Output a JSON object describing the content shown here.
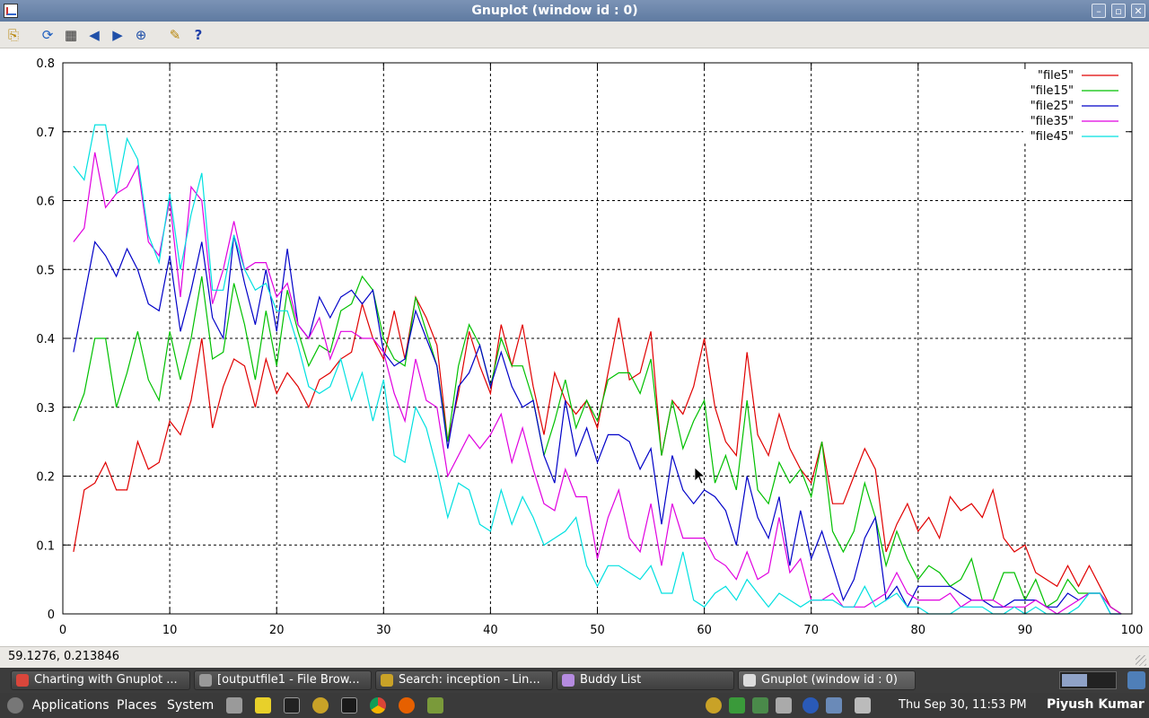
{
  "window": {
    "title": "Gnuplot (window id : 0)",
    "minimize_glyph": "–",
    "maximize_glyph": "▫",
    "close_glyph": "✕"
  },
  "toolbar": {
    "buttons": [
      {
        "name": "copy-clipboard-icon",
        "glyph": "⎘"
      },
      {
        "name": "replot-icon",
        "glyph": "⟳"
      },
      {
        "name": "grid-icon",
        "glyph": "▦"
      },
      {
        "name": "previous-zoom-icon",
        "glyph": "◀"
      },
      {
        "name": "next-zoom-icon",
        "glyph": "▶"
      },
      {
        "name": "autoscale-icon",
        "glyph": "⊕"
      },
      {
        "name": "configure-icon",
        "glyph": "✎"
      },
      {
        "name": "help-icon",
        "glyph": "?"
      }
    ]
  },
  "status": {
    "coordinates": "59.1276,  0.213846"
  },
  "chart_data": {
    "type": "line",
    "title": "",
    "xlabel": "",
    "ylabel": "",
    "xlim": [
      0,
      100
    ],
    "ylim": [
      0,
      0.8
    ],
    "xticks": [
      0,
      10,
      20,
      30,
      40,
      50,
      60,
      70,
      80,
      90,
      100
    ],
    "yticks": [
      0,
      0.1,
      0.2,
      0.3,
      0.4,
      0.5,
      0.6,
      0.7,
      0.8
    ],
    "grid": true,
    "legend_position": "top-right",
    "x": [
      1,
      2,
      3,
      4,
      5,
      6,
      7,
      8,
      9,
      10,
      11,
      12,
      13,
      14,
      15,
      16,
      17,
      18,
      19,
      20,
      21,
      22,
      23,
      24,
      25,
      26,
      27,
      28,
      29,
      30,
      31,
      32,
      33,
      34,
      35,
      36,
      37,
      38,
      39,
      40,
      41,
      42,
      43,
      44,
      45,
      46,
      47,
      48,
      49,
      50,
      51,
      52,
      53,
      54,
      55,
      56,
      57,
      58,
      59,
      60,
      61,
      62,
      63,
      64,
      65,
      66,
      67,
      68,
      69,
      70,
      71,
      72,
      73,
      74,
      75,
      76,
      77,
      78,
      79,
      80,
      81,
      82,
      83,
      84,
      85,
      86,
      87,
      88,
      89,
      90,
      91,
      92,
      93,
      94,
      95,
      96,
      97,
      98,
      99
    ],
    "series": [
      {
        "name": "\"file5\"",
        "color": "#e00000",
        "values": [
          0.09,
          0.18,
          0.19,
          0.22,
          0.18,
          0.18,
          0.25,
          0.21,
          0.22,
          0.28,
          0.26,
          0.31,
          0.4,
          0.27,
          0.33,
          0.37,
          0.36,
          0.3,
          0.37,
          0.32,
          0.35,
          0.33,
          0.3,
          0.34,
          0.35,
          0.37,
          0.38,
          0.45,
          0.4,
          0.37,
          0.44,
          0.37,
          0.46,
          0.43,
          0.39,
          0.25,
          0.32,
          0.41,
          0.36,
          0.32,
          0.42,
          0.36,
          0.42,
          0.33,
          0.26,
          0.35,
          0.31,
          0.29,
          0.31,
          0.27,
          0.35,
          0.43,
          0.34,
          0.35,
          0.41,
          0.23,
          0.31,
          0.29,
          0.33,
          0.4,
          0.3,
          0.25,
          0.23,
          0.38,
          0.26,
          0.23,
          0.29,
          0.24,
          0.21,
          0.19,
          0.25,
          0.16,
          0.16,
          0.2,
          0.24,
          0.21,
          0.09,
          0.13,
          0.16,
          0.12,
          0.14,
          0.11,
          0.17,
          0.15,
          0.16,
          0.14,
          0.18,
          0.11,
          0.09,
          0.1,
          0.06,
          0.05,
          0.04,
          0.07,
          0.04,
          0.07,
          0.04,
          0.01,
          0.0
        ]
      },
      {
        "name": "\"file15\"",
        "color": "#00c000",
        "values": [
          0.28,
          0.32,
          0.4,
          0.4,
          0.3,
          0.35,
          0.41,
          0.34,
          0.31,
          0.41,
          0.34,
          0.4,
          0.49,
          0.37,
          0.38,
          0.48,
          0.42,
          0.34,
          0.44,
          0.36,
          0.47,
          0.41,
          0.36,
          0.39,
          0.38,
          0.44,
          0.45,
          0.49,
          0.47,
          0.4,
          0.37,
          0.36,
          0.46,
          0.41,
          0.36,
          0.25,
          0.36,
          0.42,
          0.39,
          0.33,
          0.4,
          0.36,
          0.36,
          0.31,
          0.23,
          0.28,
          0.34,
          0.27,
          0.31,
          0.28,
          0.34,
          0.35,
          0.35,
          0.32,
          0.37,
          0.23,
          0.31,
          0.24,
          0.28,
          0.31,
          0.19,
          0.23,
          0.18,
          0.31,
          0.18,
          0.16,
          0.22,
          0.19,
          0.21,
          0.17,
          0.25,
          0.12,
          0.09,
          0.12,
          0.19,
          0.14,
          0.07,
          0.12,
          0.08,
          0.05,
          0.07,
          0.06,
          0.04,
          0.05,
          0.08,
          0.02,
          0.02,
          0.06,
          0.06,
          0.02,
          0.05,
          0.01,
          0.02,
          0.05,
          0.03,
          0.03,
          0.03,
          0.01,
          0.0
        ]
      },
      {
        "name": "\"file25\"",
        "color": "#0000c8",
        "values": [
          0.38,
          0.46,
          0.54,
          0.52,
          0.49,
          0.53,
          0.5,
          0.45,
          0.44,
          0.52,
          0.41,
          0.47,
          0.54,
          0.43,
          0.4,
          0.55,
          0.48,
          0.42,
          0.5,
          0.41,
          0.53,
          0.42,
          0.4,
          0.46,
          0.43,
          0.46,
          0.47,
          0.45,
          0.47,
          0.38,
          0.36,
          0.37,
          0.44,
          0.4,
          0.36,
          0.24,
          0.33,
          0.35,
          0.39,
          0.33,
          0.38,
          0.33,
          0.3,
          0.31,
          0.23,
          0.19,
          0.31,
          0.23,
          0.27,
          0.22,
          0.26,
          0.26,
          0.25,
          0.21,
          0.24,
          0.13,
          0.23,
          0.18,
          0.16,
          0.18,
          0.17,
          0.15,
          0.1,
          0.2,
          0.14,
          0.11,
          0.17,
          0.07,
          0.15,
          0.08,
          0.12,
          0.07,
          0.02,
          0.05,
          0.11,
          0.14,
          0.02,
          0.04,
          0.01,
          0.04,
          0.04,
          0.04,
          0.04,
          0.03,
          0.02,
          0.02,
          0.01,
          0.01,
          0.02,
          0.02,
          0.02,
          0.01,
          0.01,
          0.03,
          0.02,
          0.03,
          0.03,
          0.0,
          0.0
        ]
      },
      {
        "name": "\"file35\"",
        "color": "#e000e0",
        "values": [
          0.54,
          0.56,
          0.67,
          0.59,
          0.61,
          0.62,
          0.65,
          0.54,
          0.52,
          0.6,
          0.46,
          0.62,
          0.6,
          0.45,
          0.5,
          0.57,
          0.5,
          0.51,
          0.51,
          0.46,
          0.48,
          0.42,
          0.4,
          0.43,
          0.37,
          0.41,
          0.41,
          0.4,
          0.4,
          0.38,
          0.32,
          0.28,
          0.37,
          0.31,
          0.3,
          0.2,
          0.23,
          0.26,
          0.24,
          0.26,
          0.29,
          0.22,
          0.27,
          0.21,
          0.16,
          0.15,
          0.21,
          0.17,
          0.17,
          0.08,
          0.14,
          0.18,
          0.11,
          0.09,
          0.16,
          0.07,
          0.16,
          0.11,
          0.11,
          0.11,
          0.08,
          0.07,
          0.05,
          0.09,
          0.05,
          0.06,
          0.14,
          0.06,
          0.08,
          0.02,
          0.02,
          0.03,
          0.01,
          0.01,
          0.01,
          0.02,
          0.03,
          0.06,
          0.03,
          0.02,
          0.02,
          0.02,
          0.03,
          0.01,
          0.02,
          0.02,
          0.02,
          0.01,
          0.01,
          0.01,
          0.02,
          0.01,
          0.0,
          0.01,
          0.02,
          0.03,
          0.03,
          0.01,
          0.0
        ]
      },
      {
        "name": "\"file45\"",
        "color": "#00e0e0",
        "values": [
          0.65,
          0.63,
          0.71,
          0.71,
          0.61,
          0.69,
          0.66,
          0.55,
          0.51,
          0.61,
          0.5,
          0.58,
          0.64,
          0.47,
          0.47,
          0.55,
          0.5,
          0.47,
          0.48,
          0.44,
          0.44,
          0.39,
          0.33,
          0.32,
          0.33,
          0.37,
          0.31,
          0.35,
          0.28,
          0.34,
          0.23,
          0.22,
          0.3,
          0.27,
          0.21,
          0.14,
          0.19,
          0.18,
          0.13,
          0.12,
          0.18,
          0.13,
          0.17,
          0.14,
          0.1,
          0.11,
          0.12,
          0.14,
          0.07,
          0.04,
          0.07,
          0.07,
          0.06,
          0.05,
          0.07,
          0.03,
          0.03,
          0.09,
          0.02,
          0.01,
          0.03,
          0.04,
          0.02,
          0.05,
          0.03,
          0.01,
          0.03,
          0.02,
          0.01,
          0.02,
          0.02,
          0.02,
          0.01,
          0.01,
          0.04,
          0.01,
          0.02,
          0.03,
          0.01,
          0.01,
          0.0,
          0.0,
          0.0,
          0.01,
          0.01,
          0.01,
          0.0,
          0.0,
          0.01,
          0.0,
          0.01,
          0.0,
          0.0,
          0.0,
          0.01,
          0.03,
          0.03,
          0.0,
          0.0
        ]
      }
    ]
  },
  "taskbar": {
    "tasks": [
      {
        "label": "Charting with Gnuplot ...",
        "icon_color": "#d9463b",
        "active": false
      },
      {
        "label": "[outputfile1 - File Brow...",
        "icon_color": "#9a9a9a",
        "active": false
      },
      {
        "label": "Search: inception - Lin...",
        "icon_color": "#c9a227",
        "active": false
      },
      {
        "label": "Buddy List",
        "icon_color": "#b58be0",
        "active": false
      },
      {
        "label": "Gnuplot (window id : 0)",
        "icon_color": "#dddddd",
        "active": true
      }
    ]
  },
  "panel": {
    "menus": [
      "Applications",
      "Places",
      "System"
    ],
    "clock": "Thu Sep 30, 11:53 PM",
    "user": "Piyush Kumar"
  }
}
